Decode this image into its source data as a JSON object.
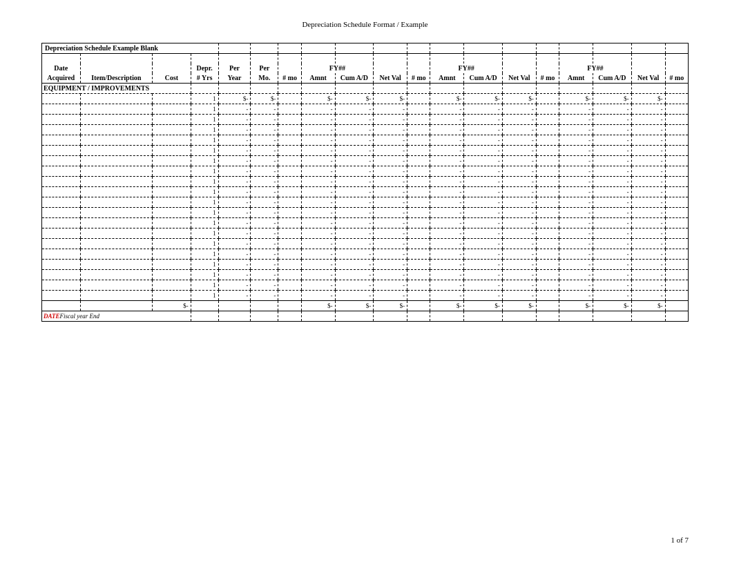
{
  "page_title": "Depreciation Schedule Format / Example",
  "sheet_title": "Depreciation Schedule Example Blank",
  "section_heading": "EQUIPMENT / IMPROVEMENTS",
  "header_row1": {
    "date": "Date",
    "depr": "Depr.",
    "per1": "Per",
    "per2": "Per",
    "fy": "FY##"
  },
  "header_row2": {
    "acquired": "Acquired",
    "item": "Item/Description",
    "cost": "Cost",
    "yrs": "# Yrs",
    "year": "Year",
    "mo": "Mo.",
    "nmo": "# mo",
    "amnt": "Amnt",
    "cum": "Cum A/D",
    "netval": "Net Val"
  },
  "data_row_count": 20,
  "data_row": {
    "yrs": "1",
    "first_year": "$-",
    "first_mo": "$-",
    "dash": "-",
    "dollar_dash": "$-"
  },
  "totals": {
    "cost": "$-",
    "amnt": "$-",
    "cum": "$-",
    "netval": "$-"
  },
  "footer": {
    "date": "DATE",
    "label": "Fiscal year End"
  },
  "page_number": "1 of 7"
}
